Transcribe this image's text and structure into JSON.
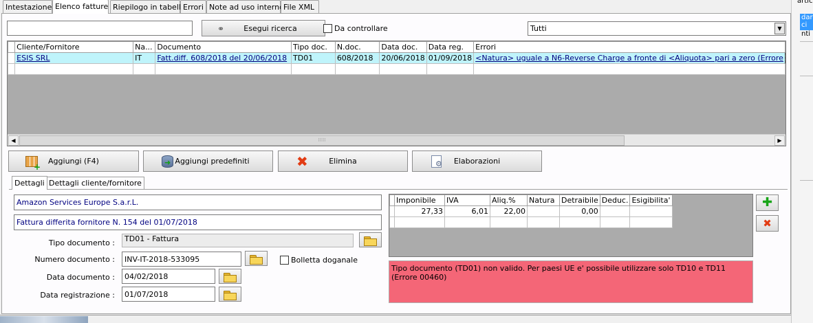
{
  "tabs": [
    "Intestazione",
    "Elenco fatture",
    "Riepilogo in tabella",
    "Errori",
    "Note ad uso interno",
    "File XML"
  ],
  "search": {
    "value": "",
    "button_label": "Esegui ricerca",
    "checkbox_label": "Da controllare",
    "filter_selected": "Tutti"
  },
  "invoices_table": {
    "columns": [
      "Cliente/Fornitore",
      "Na...",
      "Documento",
      "Tipo doc.",
      "N.doc.",
      "Data doc.",
      "Data reg.",
      "Errori"
    ],
    "rows": [
      {
        "cliente": "ESIS SRL",
        "nazione": "IT",
        "documento": "Fatt.diff. 608/2018 del 20/06/2018",
        "tipo": "TD01",
        "ndoc": "608/2018",
        "data_doc": "20/06/2018",
        "data_reg": "01/09/2018",
        "errori": "<Natura> uguale a N6-Reverse Charge a fronte di <Aliquota> pari a zero (Errore"
      }
    ]
  },
  "actions": {
    "aggiungi": "Aggiungi (F4)",
    "predefiniti": "Aggiungi predefiniti",
    "elimina": "Elimina",
    "elaborazioni": "Elaborazioni"
  },
  "subtabs": [
    "Dettagli",
    "Dettagli cliente/fornitore"
  ],
  "details": {
    "supplier_name": "Amazon Services Europe S.a.r.L.",
    "description": "Fattura differita fornitore N. 154 del 01/07/2018",
    "tipo_documento_label": "Tipo documento :",
    "tipo_documento_value": "TD01 - Fattura",
    "numero_documento_label": "Numero documento :",
    "numero_documento_value": "INV-IT-2018-533095",
    "bolletta_label": "Bolletta doganale",
    "data_documento_label": "Data documento :",
    "data_documento_value": "04/02/2018",
    "data_registrazione_label": "Data registrazione :",
    "data_registrazione_value": "01/07/2018"
  },
  "vat_table": {
    "columns": [
      "Imponibile",
      "IVA",
      "Aliq.%",
      "Natura",
      "Detraibile",
      "Deduc.",
      "Esigibilita'"
    ],
    "rows": [
      {
        "imponibile": "27,33",
        "iva": "6,01",
        "aliq": "22,00",
        "natura": "",
        "detraibile": "0,00",
        "deduc": "",
        "esig": ""
      }
    ]
  },
  "error_message": "Tipo documento (TD01) non valido. Per paesi UE e' possibile utilizzare solo TD10 e TD11 (Errore 00460)",
  "background_window": {
    "line1": "artic",
    "line2": "dard",
    "line3": "ci",
    "line4": "nti"
  },
  "colors": {
    "selected_row": "#bff4fb",
    "error_bg": "#f46677",
    "link_text": "#000080",
    "grid_bg": "#ababab"
  }
}
